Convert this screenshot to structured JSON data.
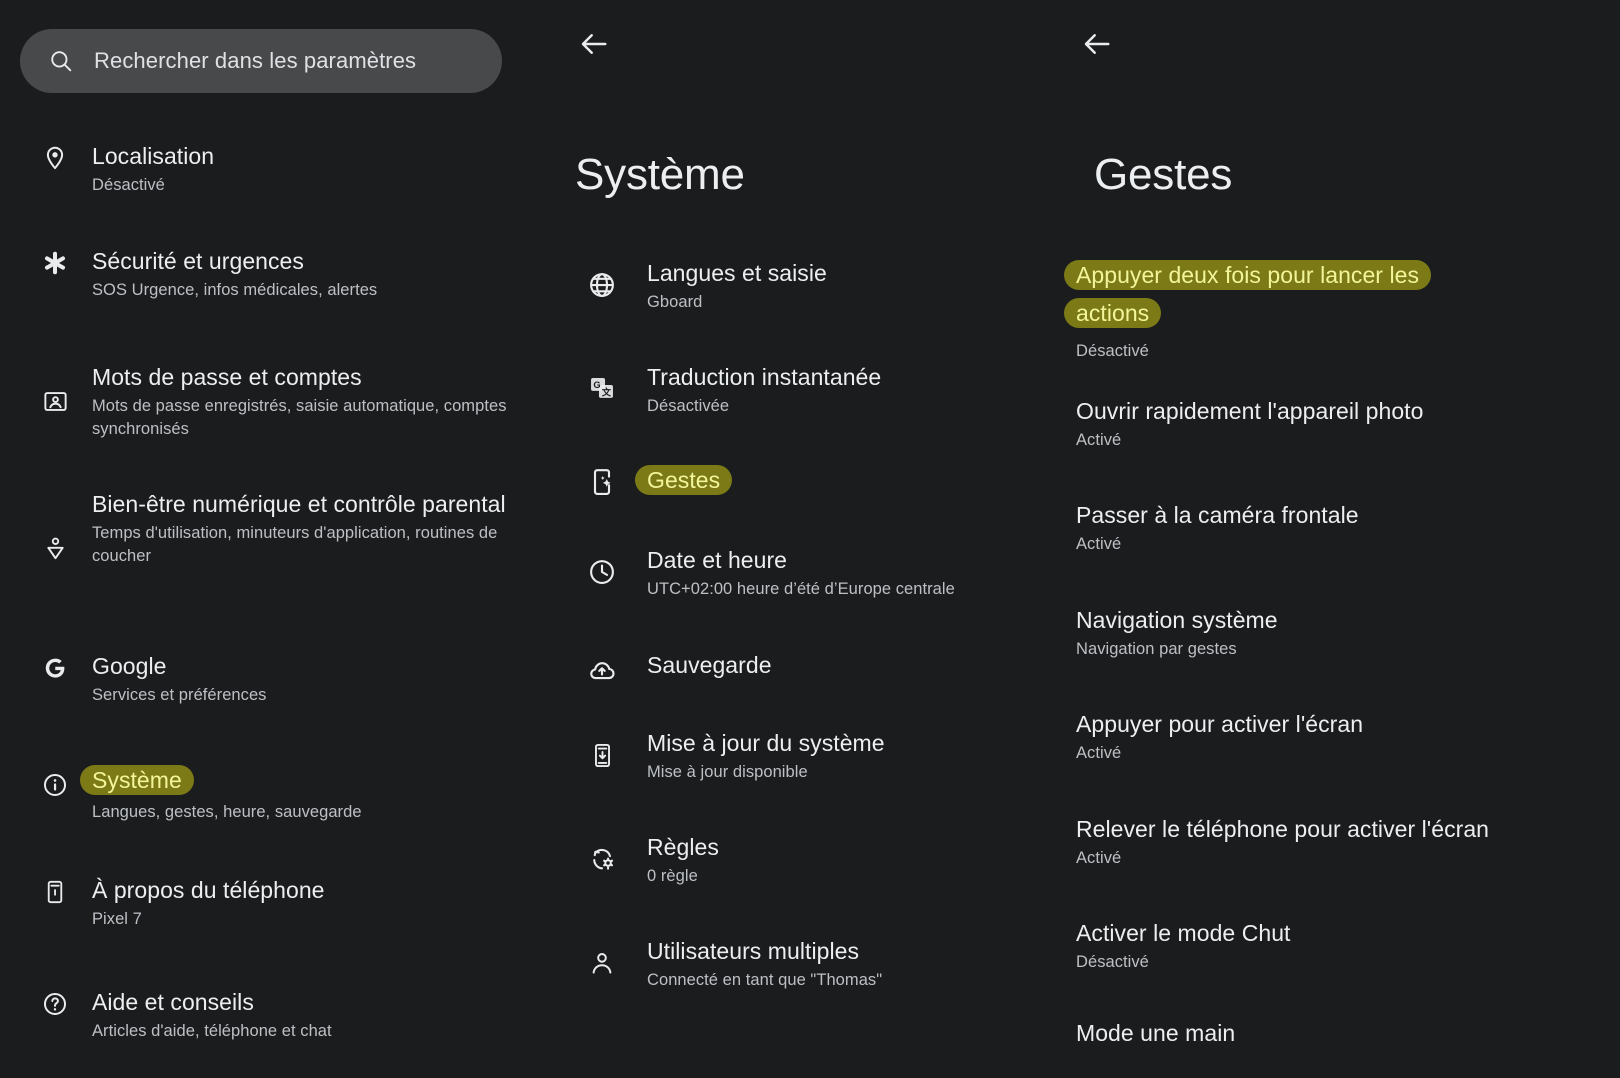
{
  "theme": {
    "background": "#1b1c1e",
    "search_bg": "#48494b",
    "title_color": "#eceff1",
    "subtitle_color": "#bcc0c4",
    "highlight_bg": "#7b7a17",
    "highlight_text": "#f3f59a"
  },
  "search": {
    "placeholder": "Rechercher dans les paramètres",
    "icon": "search-icon"
  },
  "left_panel": {
    "items": [
      {
        "icon": "location-pin-icon",
        "title": "Localisation",
        "subtitle": "Désactivé",
        "highlighted": false
      },
      {
        "icon": "asterisk-emergency-icon",
        "title": "Sécurité et urgences",
        "subtitle": "SOS Urgence, infos médicales, alertes",
        "highlighted": false
      },
      {
        "icon": "passwords-accounts-icon",
        "title": "Mots de passe et comptes",
        "subtitle": "Mots de passe enregistrés, saisie automatique, comptes synchronisés",
        "highlighted": false
      },
      {
        "icon": "digital-wellbeing-icon",
        "title": "Bien-être numérique et contrôle parental",
        "subtitle": "Temps d'utilisation, minuteurs d'application, routines de coucher",
        "highlighted": false
      },
      {
        "icon": "google-g-icon",
        "title": "Google",
        "subtitle": "Services et préférences",
        "highlighted": false
      },
      {
        "icon": "info-circle-icon",
        "title": "Système",
        "subtitle": "Langues, gestes, heure, sauvegarde",
        "highlighted": true
      },
      {
        "icon": "phone-info-icon",
        "title": "À propos du téléphone",
        "subtitle": "Pixel 7",
        "highlighted": false
      },
      {
        "icon": "help-circle-icon",
        "title": "Aide et conseils",
        "subtitle": "Articles d'aide, téléphone et chat",
        "highlighted": false
      }
    ]
  },
  "mid_panel": {
    "back_icon": "back-arrow-icon",
    "title": "Système",
    "items": [
      {
        "icon": "globe-icon",
        "title": "Langues et saisie",
        "subtitle": "Gboard",
        "highlighted": false
      },
      {
        "icon": "translate-icon",
        "title": "Traduction instantanée",
        "subtitle": "Désactivée",
        "highlighted": false
      },
      {
        "icon": "gestures-phone-icon",
        "title": "Gestes",
        "subtitle": "",
        "highlighted": true
      },
      {
        "icon": "clock-icon",
        "title": "Date et heure",
        "subtitle": "UTC+02:00 heure d’été d’Europe centrale",
        "highlighted": false
      },
      {
        "icon": "cloud-upload-icon",
        "title": "Sauvegarde",
        "subtitle": "",
        "highlighted": false
      },
      {
        "icon": "system-update-icon",
        "title": "Mise à jour du système",
        "subtitle": "Mise à jour disponible",
        "highlighted": false
      },
      {
        "icon": "rules-gear-icon",
        "title": "Règles",
        "subtitle": "0 règle",
        "highlighted": false
      },
      {
        "icon": "person-icon",
        "title": "Utilisateurs multiples",
        "subtitle": "Connecté en tant que \"Thomas\"",
        "highlighted": false
      }
    ]
  },
  "right_panel": {
    "back_icon": "back-arrow-icon",
    "title": "Gestes",
    "items": [
      {
        "title": "Appuyer deux fois pour lancer les actions",
        "subtitle": "Désactivé",
        "highlighted": true
      },
      {
        "title": "Ouvrir rapidement l'appareil photo",
        "subtitle": "Activé",
        "highlighted": false
      },
      {
        "title": "Passer à la caméra frontale",
        "subtitle": "Activé",
        "highlighted": false
      },
      {
        "title": "Navigation système",
        "subtitle": "Navigation par gestes",
        "highlighted": false
      },
      {
        "title": "Appuyer pour activer l'écran",
        "subtitle": "Activé",
        "highlighted": false
      },
      {
        "title": "Relever le téléphone pour activer l'écran",
        "subtitle": "Activé",
        "highlighted": false
      },
      {
        "title": "Activer le mode Chut",
        "subtitle": "Désactivé",
        "highlighted": false
      },
      {
        "title": "Mode une main",
        "subtitle": "",
        "highlighted": false
      }
    ]
  }
}
